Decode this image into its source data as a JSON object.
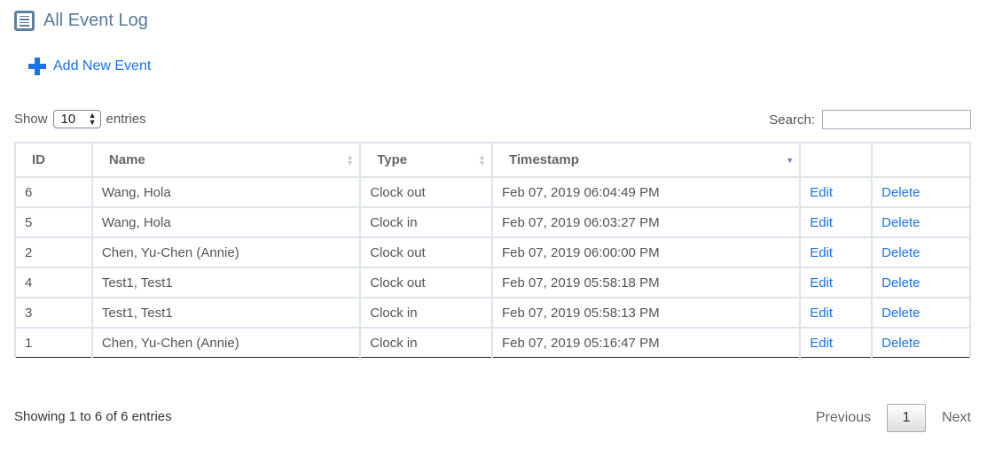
{
  "header": {
    "title": "All Event Log",
    "icon": "document-list-icon"
  },
  "add_button": {
    "label": "Add New Event",
    "icon": "plus-icon"
  },
  "length": {
    "prefix": "Show",
    "value": "10",
    "suffix": "entries"
  },
  "search": {
    "label": "Search:",
    "value": ""
  },
  "table": {
    "columns": [
      "ID",
      "Name",
      "Type",
      "Timestamp",
      "",
      ""
    ],
    "sorted_column": "Timestamp",
    "sort_direction": "descending",
    "rows": [
      {
        "id": "6",
        "name": "Wang, Hola",
        "type": "Clock out",
        "timestamp": "Feb 07, 2019 06:04:49 PM",
        "edit": "Edit",
        "delete": "Delete"
      },
      {
        "id": "5",
        "name": "Wang, Hola",
        "type": "Clock in",
        "timestamp": "Feb 07, 2019 06:03:27 PM",
        "edit": "Edit",
        "delete": "Delete"
      },
      {
        "id": "2",
        "name": "Chen, Yu-Chen (Annie)",
        "type": "Clock out",
        "timestamp": "Feb 07, 2019 06:00:00 PM",
        "edit": "Edit",
        "delete": "Delete"
      },
      {
        "id": "4",
        "name": "Test1, Test1",
        "type": "Clock out",
        "timestamp": "Feb 07, 2019 05:58:18 PM",
        "edit": "Edit",
        "delete": "Delete"
      },
      {
        "id": "3",
        "name": "Test1, Test1",
        "type": "Clock in",
        "timestamp": "Feb 07, 2019 05:58:13 PM",
        "edit": "Edit",
        "delete": "Delete"
      },
      {
        "id": "1",
        "name": "Chen, Yu-Chen (Annie)",
        "type": "Clock in",
        "timestamp": "Feb 07, 2019 05:16:47 PM",
        "edit": "Edit",
        "delete": "Delete"
      }
    ]
  },
  "footer": {
    "info": "Showing 1 to 6 of 6 entries",
    "previous": "Previous",
    "page": "1",
    "next": "Next"
  },
  "colors": {
    "link": "#1a73e8",
    "title": "#5b7a99",
    "sort_active": "#7b6fd6"
  }
}
